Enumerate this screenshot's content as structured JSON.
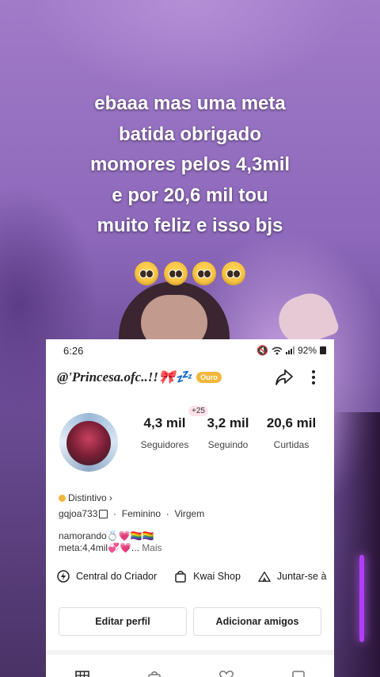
{
  "caption": {
    "text": "ebaaa mas uma meta\nbatida obrigado\nmomores pelos 4,3mil\ne por 20,6 mil tou\nmuito feliz e isso bjs",
    "emoji": "🥺🥺🥺🥺"
  },
  "status_bar": {
    "time": "6:26",
    "battery": "92%"
  },
  "profile": {
    "username": "@'Princesa.ofc..!!🎀💤",
    "badge": "Ouro",
    "stats": {
      "followers_value": "4,3 mil",
      "followers_label": "Seguidores",
      "followers_delta": "+25",
      "following_value": "3,2 mil",
      "following_label": "Seguindo",
      "likes_value": "20,6 mil",
      "likes_label": "Curtidas"
    },
    "distintivo": "Distintivo",
    "info": {
      "id": "gqjoa733",
      "gender": "Feminino",
      "sign": "Virgem"
    },
    "bio_line1": "namorando💍💗🏳️‍🌈🏳️‍🌈",
    "bio_line2": "meta:4,4mil💞💗...",
    "bio_more": "Mais"
  },
  "shortcuts": {
    "creator": "Central do Criador",
    "shop": "Kwai Shop",
    "join": "Juntar-se à"
  },
  "buttons": {
    "edit": "Editar perfil",
    "add": "Adicionar amigos"
  },
  "icons": {
    "share": "share-arrow-icon",
    "more": "more-vertical-icon",
    "creator": "lightning-icon",
    "shop": "shopping-bag-icon",
    "join": "tent-icon",
    "tabs": [
      "grid-icon",
      "lock-bag-icon",
      "heart-icon",
      "square-icon"
    ]
  }
}
